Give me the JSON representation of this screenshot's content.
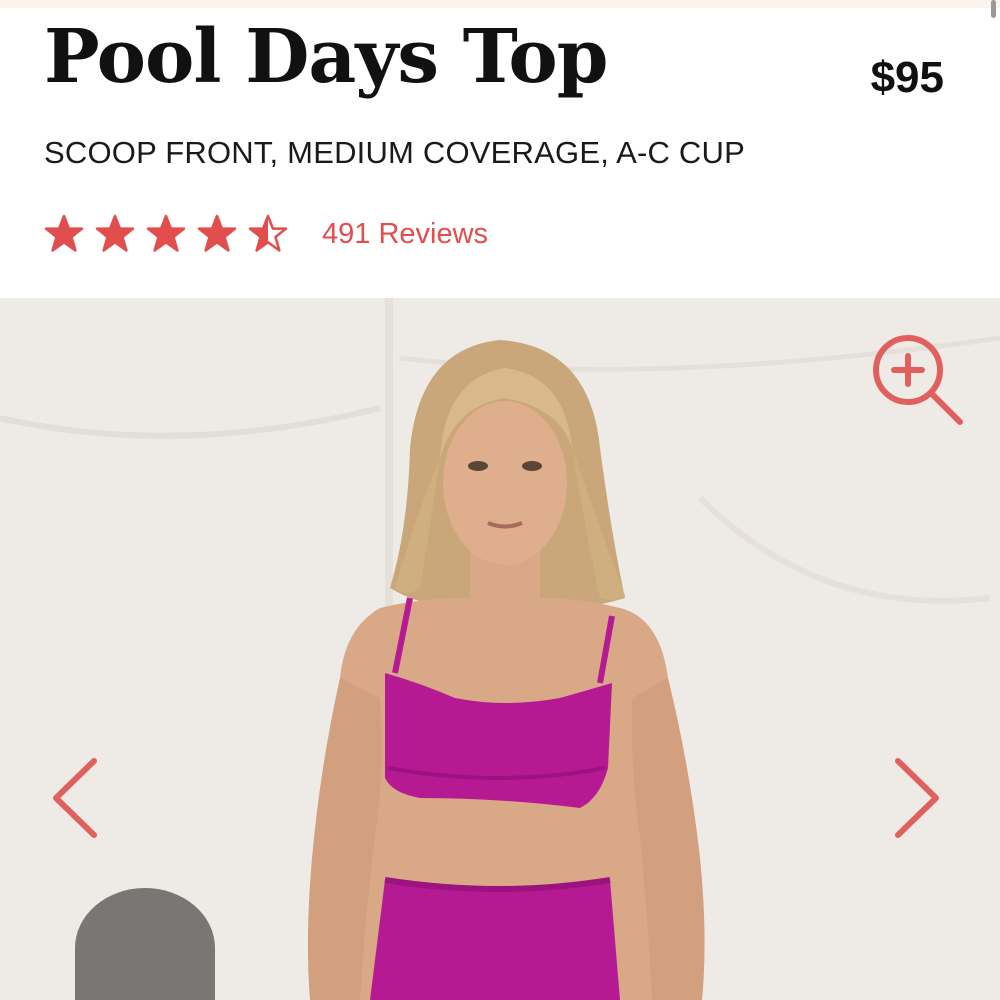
{
  "product": {
    "title": "Pool Days Top",
    "price": "$95",
    "subtitle": "SCOOP FRONT, MEDIUM COVERAGE, A-C CUP",
    "rating": 4.5,
    "rating_max": 5,
    "reviews_label": "491 Reviews"
  },
  "gallery": {
    "icons": {
      "zoom": "zoom-in-icon",
      "prev": "chevron-left-icon",
      "next": "chevron-right-icon"
    }
  },
  "colors": {
    "accent": "#e24d4d",
    "top_fabric": "#b51a93",
    "backdrop": "#eeeae5"
  }
}
